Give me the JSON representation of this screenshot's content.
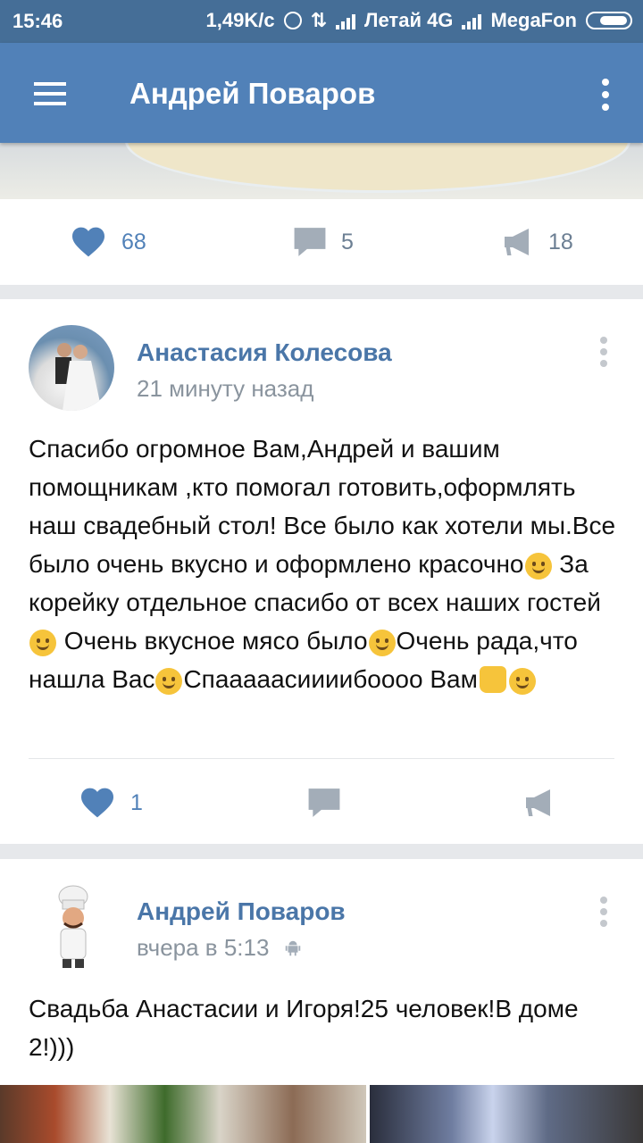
{
  "status_bar": {
    "time": "15:46",
    "speed": "1,49K/c",
    "network1": "Летай 4G",
    "network2": "MegaFon"
  },
  "app_bar": {
    "title": "Андрей Поваров"
  },
  "prev_post": {
    "likes": "68",
    "comments": "5",
    "reposts": "18"
  },
  "post1": {
    "author": "Анастасия Колесова",
    "time": "21 минуту назад",
    "text_parts": [
      "Спасибо огромное Вам,Андрей и вашим помощникам ,кто помогал готовить,оформлять наш свадебный стол! Все было как хотели мы.Все было очень вкусно и оформлено красочно",
      " За корейку отдельное спасибо от всех наших гостей",
      " Очень вкусное мясо было",
      "Очень рада,что нашла Вас",
      "Спааааасиииибоооо Вам"
    ],
    "likes": "1"
  },
  "post2": {
    "author": "Андрей Поваров",
    "time": "вчера в 5:13",
    "text": "Свадьба Анастасии и Игоря!25 человек!В доме 2!)))"
  },
  "colors": {
    "accent": "#5181b8",
    "status_bar": "#456e97",
    "link": "#4a76a8"
  },
  "icons": [
    "menu-icon",
    "more-vert-icon",
    "heart-icon",
    "comment-icon",
    "share-megaphone-icon",
    "android-icon"
  ]
}
